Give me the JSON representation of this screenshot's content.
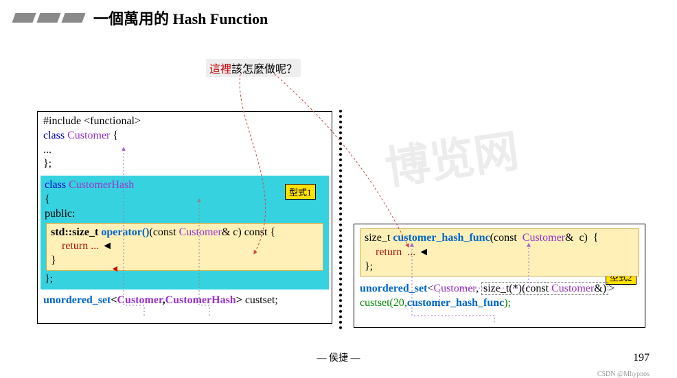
{
  "header": {
    "title": "一個萬用的 Hash Function"
  },
  "callout": {
    "highlight": "這裡",
    "rest": "該怎麼做呢？"
  },
  "left": {
    "line1_inc": "#include <functional>",
    "line2_class_kw": "class",
    "line2_name": " Customer",
    "line2_brace": " {",
    "line3": "...",
    "line4": "};",
    "hash_class_kw": "class",
    "hash_name": " CustomerHash",
    "hash_open": "{",
    "hash_public": "public:",
    "op_pre": "std::size_t ",
    "op_name": "operator()",
    "op_args_pre": "(const ",
    "op_cust": "Customer",
    "op_args_post": "& c) const {",
    "ret_kw": "    return",
    "ret_dots": " ...",
    "op_close": "}",
    "hash_close": "};",
    "use_pre": "unordered_set",
    "use_lt": "<",
    "use_c1": "Customer",
    "use_comma": ",",
    "use_c2": "CustomerHash",
    "use_gt": ">",
    "use_var": " custset;"
  },
  "right": {
    "fn_pre": "size_t ",
    "fn_name": "customer_hash_func",
    "fn_args_pre": "(const  ",
    "fn_cust": "Customer",
    "fn_args_post": "&  c)  {",
    "ret_kw": "    return",
    "ret_dots": "  ...",
    "fn_close": "};",
    "use_pre": "unordered_set",
    "use_lt": "<",
    "use_c1": "Customer",
    "use_comma": ", ",
    "dashed_pre": "size_t(*)(const ",
    "dashed_cust": "Customer",
    "dashed_post": "&)",
    "use_gt": ">",
    "line2_var": "custset(20,",
    "line2_fn": "customer_hash_func",
    "line2_end": ");"
  },
  "badges": {
    "b1": "型式1",
    "b2": "型式2"
  },
  "footer": {
    "author": "— 侯捷 —",
    "page": "197",
    "credit": "CSDN @Mhypnos"
  }
}
